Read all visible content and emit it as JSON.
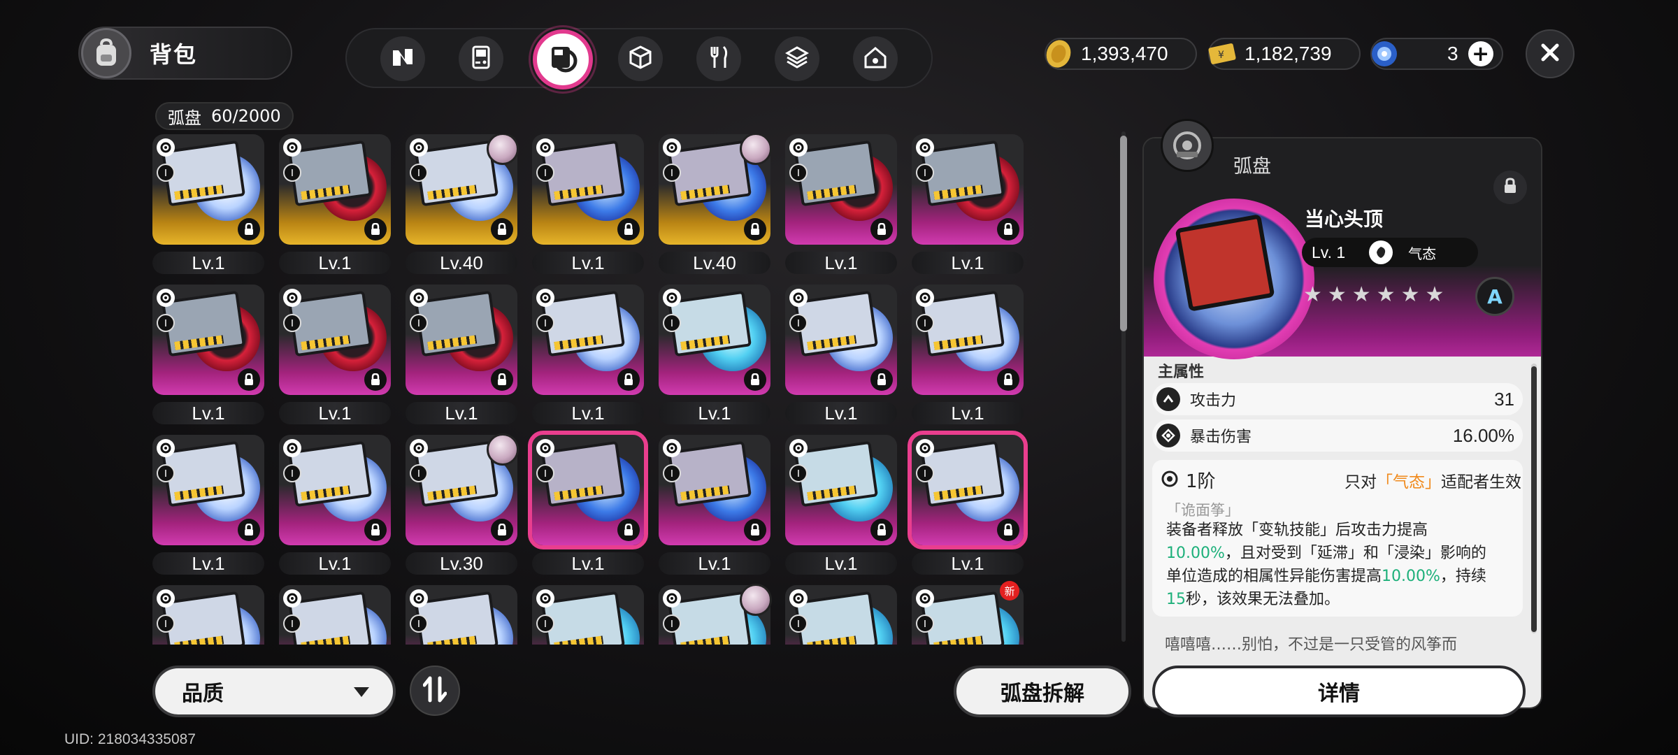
{
  "header": {
    "title": "背包",
    "tabs": [
      {
        "icon": "n-logo-icon"
      },
      {
        "icon": "gameboy-icon"
      },
      {
        "icon": "disc-drive-icon",
        "active": true
      },
      {
        "icon": "cube-icon"
      },
      {
        "icon": "utensils-icon"
      },
      {
        "icon": "stack-icon"
      },
      {
        "icon": "house-icon"
      }
    ],
    "currencies": {
      "dennies": "1,393,470",
      "tickets": "1,182,739",
      "polychrome": "3"
    }
  },
  "inventory": {
    "label": "弧盘",
    "count": "60/2000",
    "items": [
      {
        "level": "Lv.1",
        "tier": "I",
        "frame": "gold",
        "disc": "white"
      },
      {
        "level": "Lv.1",
        "tier": "I",
        "frame": "gold",
        "disc": "red"
      },
      {
        "level": "Lv.40",
        "tier": "I",
        "frame": "gold",
        "disc": "white",
        "avatar": true
      },
      {
        "level": "Lv.1",
        "tier": "I",
        "frame": "gold",
        "disc": "blue"
      },
      {
        "level": "Lv.40",
        "tier": "I",
        "frame": "gold",
        "disc": "blue",
        "avatar": true
      },
      {
        "level": "Lv.1",
        "tier": "I",
        "frame": "pink",
        "disc": "red"
      },
      {
        "level": "Lv.1",
        "tier": "I",
        "frame": "pink",
        "disc": "red"
      },
      {
        "level": "Lv.1",
        "tier": "I",
        "frame": "pink",
        "disc": "red"
      },
      {
        "level": "Lv.1",
        "tier": "I",
        "frame": "pink",
        "disc": "red"
      },
      {
        "level": "Lv.1",
        "tier": "I",
        "frame": "pink",
        "disc": "red"
      },
      {
        "level": "Lv.1",
        "tier": "I",
        "frame": "pink",
        "disc": "white"
      },
      {
        "level": "Lv.1",
        "tier": "I",
        "frame": "pink",
        "disc": "cyan"
      },
      {
        "level": "Lv.1",
        "tier": "I",
        "frame": "pink",
        "disc": "white"
      },
      {
        "level": "Lv.1",
        "tier": "I",
        "frame": "pink",
        "disc": "white"
      },
      {
        "level": "Lv.1",
        "tier": "I",
        "frame": "pink",
        "disc": "white"
      },
      {
        "level": "Lv.1",
        "tier": "I",
        "frame": "pink",
        "disc": "white"
      },
      {
        "level": "Lv.30",
        "tier": "I",
        "frame": "pink",
        "disc": "white",
        "avatar": true
      },
      {
        "level": "Lv.1",
        "tier": "I",
        "frame": "pink",
        "disc": "blue",
        "selected": true
      },
      {
        "level": "Lv.1",
        "tier": "I",
        "frame": "pink",
        "disc": "blue"
      },
      {
        "level": "Lv.1",
        "tier": "I",
        "frame": "pink",
        "disc": "cyan"
      },
      {
        "level": "Lv.1",
        "tier": "I",
        "frame": "pink",
        "disc": "white",
        "selected": true
      },
      {
        "level": "",
        "tier": "I",
        "frame": "pink",
        "disc": "white"
      },
      {
        "level": "",
        "tier": "I",
        "frame": "pink",
        "disc": "white"
      },
      {
        "level": "",
        "tier": "I",
        "frame": "pink",
        "disc": "white"
      },
      {
        "level": "",
        "tier": "I",
        "frame": "pink",
        "disc": "cyan"
      },
      {
        "level": "",
        "tier": "I",
        "frame": "pink",
        "disc": "cyan",
        "avatar": true
      },
      {
        "level": "",
        "tier": "I",
        "frame": "pink",
        "disc": "cyan"
      },
      {
        "level": "",
        "tier": "I",
        "frame": "pink",
        "disc": "cyan",
        "new": "新"
      }
    ]
  },
  "filters": {
    "sort_label": "品质",
    "dismantle_label": "弧盘拆解"
  },
  "uid": "UID: 218034335087",
  "detail": {
    "category": "弧盘",
    "name": "当心头顶",
    "level": "Lv. 1",
    "attribute": "气态",
    "stars": "★★★★★★",
    "rank": "A",
    "main_stats_label": "主属性",
    "stats": [
      {
        "name": "攻击力",
        "value": "31"
      },
      {
        "name": "暴击伤害",
        "value": "16.00%"
      }
    ],
    "set_tier": "1阶",
    "set_cond_pre": "只对",
    "set_cond_attr": "「气态」",
    "set_cond_post": "适配者生效",
    "set_name": "「诡面筝」",
    "set_desc_1": "装备者释放「变轨技能」后攻击力提高",
    "set_desc_2a": "10.00%",
    "set_desc_2b": "，且对受到「延滞」和「浸染」影响的",
    "set_desc_3a": "单位造成的相属性异能伤害提高",
    "set_desc_3b": "10.00%",
    "set_desc_3c": "，持续",
    "set_desc_4a": "15",
    "set_desc_4b": "秒，该效果无法叠加。",
    "lore": "嘻嘻嘻……别怕，不过是一只受管的风筝而",
    "detail_button": "详情"
  },
  "colors": {
    "accent": "#e93e8e",
    "gold_frame": "#e7b52a",
    "pink_frame": "#d13bb0",
    "green_text": "#1db07a",
    "orange_text": "#f08a1c"
  }
}
